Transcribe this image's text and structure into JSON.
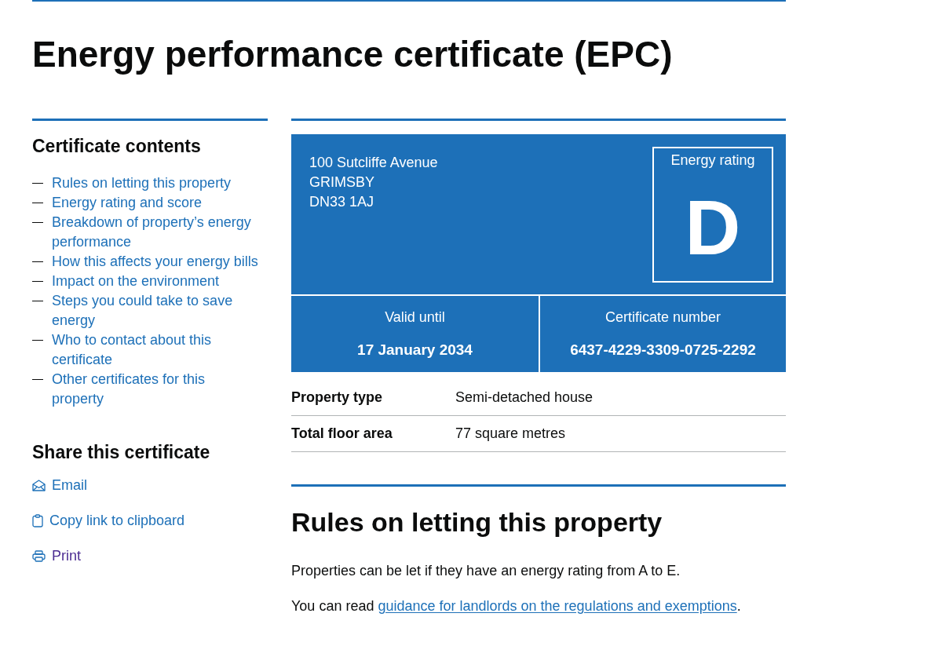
{
  "page_title": "Energy performance certificate (EPC)",
  "sidebar": {
    "contents": {
      "heading": "Certificate contents",
      "items": [
        {
          "label": "Rules on letting this property"
        },
        {
          "label": "Energy rating and score"
        },
        {
          "label": "Breakdown of property’s energy performance"
        },
        {
          "label": "How this affects your energy bills"
        },
        {
          "label": "Impact on the environment"
        },
        {
          "label": "Steps you could take to save energy"
        },
        {
          "label": "Who to contact about this certificate"
        },
        {
          "label": "Other certificates for this property"
        }
      ]
    },
    "share": {
      "heading": "Share this certificate",
      "items": [
        {
          "kind": "email",
          "label": "Email",
          "visited": false
        },
        {
          "kind": "clipboard",
          "label": "Copy link to clipboard",
          "visited": false
        },
        {
          "kind": "print",
          "label": "Print",
          "visited": true
        }
      ]
    }
  },
  "certificate": {
    "address_lines": [
      "100 Sutcliffe Avenue",
      "GRIMSBY",
      "DN33 1AJ"
    ],
    "rating": {
      "label": "Energy rating",
      "value": "D"
    },
    "details": [
      {
        "label": "Valid until",
        "value": "17 January 2034"
      },
      {
        "label": "Certificate number",
        "value": "6437-4229-3309-0725-2292"
      }
    ]
  },
  "summary": [
    {
      "key": "Property type",
      "value": "Semi-detached house"
    },
    {
      "key": "Total floor area",
      "value": "77 square metres"
    }
  ],
  "section": {
    "heading": "Rules on letting this property",
    "paragraphs": [
      {
        "text": "Properties can be let if they have an energy rating from A to E."
      },
      {
        "text": "You can read ",
        "link": "guidance for landlords on the regulations and exemptions",
        "after": "."
      }
    ]
  }
}
